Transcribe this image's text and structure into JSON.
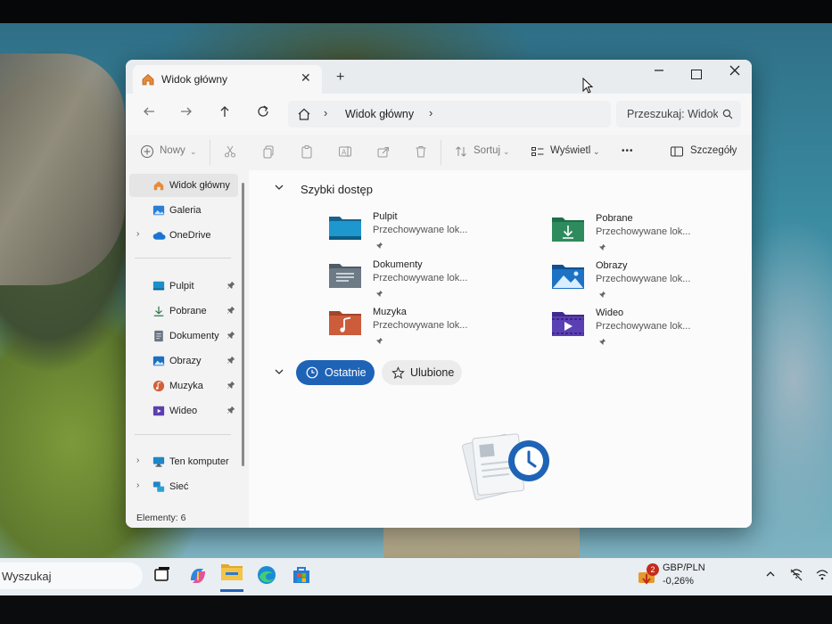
{
  "window": {
    "tab_title": "Widok główny",
    "tab_close": "✕",
    "new_tab": "+"
  },
  "address": {
    "separator": "›",
    "location": "Widok główny",
    "trail_separator": "›"
  },
  "search": {
    "placeholder": "Przeszukaj: Widok główny"
  },
  "toolbar": {
    "new_label": "Nowy",
    "sort_label": "Sortuj",
    "view_label": "Wyświetl",
    "more_label": "•••",
    "details_label": "Szczegóły"
  },
  "sidebar": {
    "top_items": [
      {
        "label": "Widok główny",
        "selected": true
      },
      {
        "label": "Galeria"
      },
      {
        "label": "OneDrive"
      }
    ],
    "pinned_items": [
      {
        "label": "Pulpit"
      },
      {
        "label": "Pobrane"
      },
      {
        "label": "Dokumenty"
      },
      {
        "label": "Obrazy"
      },
      {
        "label": "Muzyka"
      },
      {
        "label": "Wideo"
      }
    ],
    "bottom_items": [
      {
        "label": "Ten komputer"
      },
      {
        "label": "Sieć"
      }
    ],
    "chevron": "›"
  },
  "status": {
    "items_count": "Elementy: 6"
  },
  "quick_access": {
    "title": "Szybki dostęp",
    "items": [
      {
        "name": "Pulpit",
        "subtitle": "Przechowywane lok...",
        "icon": "desktop-folder-icon"
      },
      {
        "name": "Pobrane",
        "subtitle": "Przechowywane lok...",
        "icon": "downloads-folder-icon"
      },
      {
        "name": "Dokumenty",
        "subtitle": "Przechowywane lok...",
        "icon": "documents-folder-icon"
      },
      {
        "name": "Obrazy",
        "subtitle": "Przechowywane lok...",
        "icon": "pictures-folder-icon"
      },
      {
        "name": "Muzyka",
        "subtitle": "Przechowywane lok...",
        "icon": "music-folder-icon"
      },
      {
        "name": "Wideo",
        "subtitle": "Przechowywane lok...",
        "icon": "videos-folder-icon"
      }
    ]
  },
  "recent_section": {
    "recent_label": "Ostatnie",
    "favorites_label": "Ulubione"
  },
  "taskbar": {
    "search_text": "Wyszukaj",
    "widget_badge": "2",
    "widget_title": "GBP/PLN",
    "widget_value": "-0,26%"
  },
  "colors": {
    "accent": "#1f63b6",
    "window_bg": "#f3f3f3",
    "content_bg": "#fbfbfb"
  }
}
